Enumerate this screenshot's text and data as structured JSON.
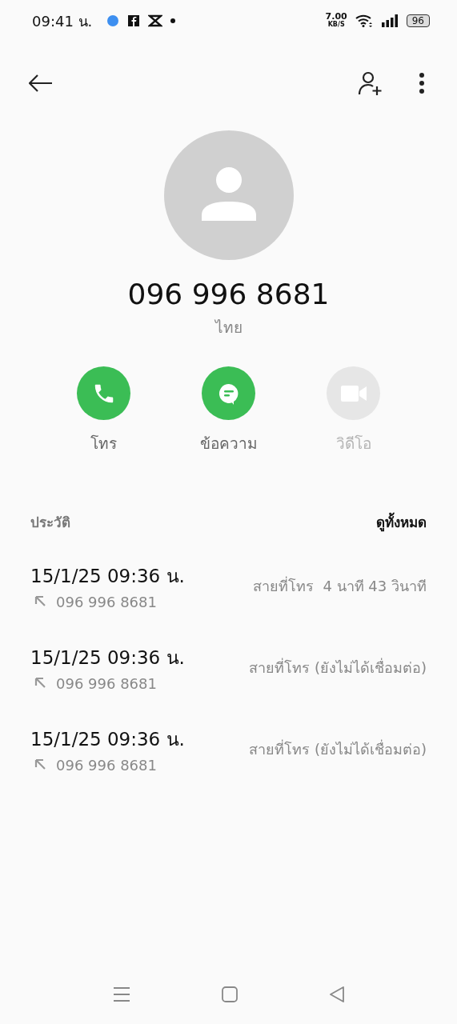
{
  "status_bar": {
    "time": "09:41 น.",
    "net_speed": "7.00",
    "net_unit": "KB/S",
    "battery": "96"
  },
  "contact": {
    "name": "096 996 8681",
    "region": "ไทย"
  },
  "actions": [
    {
      "kind": "call",
      "label": "โทร",
      "disabled": false
    },
    {
      "kind": "message",
      "label": "ข้อความ",
      "disabled": false
    },
    {
      "kind": "video",
      "label": "วิดีโอ",
      "disabled": true
    }
  ],
  "history": {
    "title": "ประวัติ",
    "see_all": "ดูทั้งหมด",
    "rows": [
      {
        "datetime": "15/1/25 09:36 น.",
        "number": "096 996 8681",
        "detail": "สายที่โทร  4 นาที 43 วินาที"
      },
      {
        "datetime": "15/1/25 09:36 น.",
        "number": "096 996 8681",
        "detail": "สายที่โทร (ยังไม่ได้เชื่อมต่อ)"
      },
      {
        "datetime": "15/1/25 09:36 น.",
        "number": "096 996 8681",
        "detail": "สายที่โทร (ยังไม่ได้เชื่อมต่อ)"
      }
    ]
  }
}
